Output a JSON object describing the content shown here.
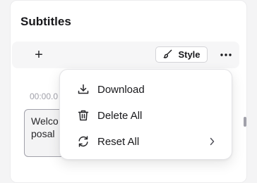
{
  "panel": {
    "title": "Subtitles"
  },
  "toolbar": {
    "add_label": "+",
    "style_label": "Style"
  },
  "subtitle_entry": {
    "timestamp": "00:00.0",
    "text_line1": "Welco",
    "text_line2": "posal"
  },
  "menu": {
    "items": [
      {
        "label": "Download",
        "icon": "download-icon"
      },
      {
        "label": "Delete All",
        "icon": "trash-icon"
      },
      {
        "label": "Reset All",
        "icon": "reset-icon",
        "submenu": true
      }
    ]
  }
}
